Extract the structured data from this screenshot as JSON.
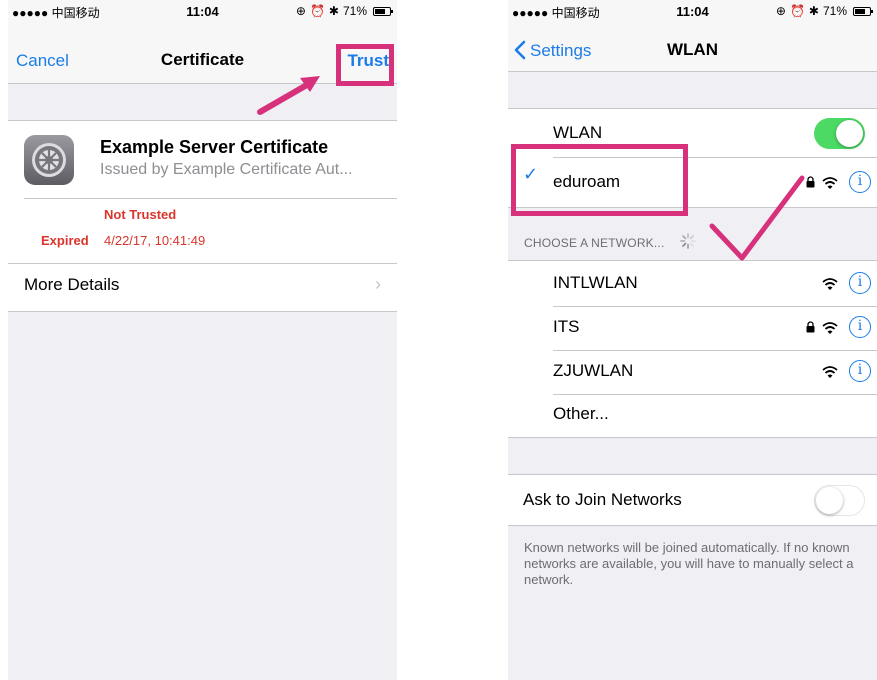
{
  "left_phone": {
    "status": {
      "carrier": "●●●●● 中国移动",
      "time": "11:04",
      "battery": "71%",
      "battery_level": 0.71
    },
    "nav": {
      "cancel": "Cancel",
      "title": "Certificate",
      "trust": "Trust"
    },
    "certificate": {
      "name": "Example Server Certificate",
      "issuer": "Issued by Example Certificate Aut...",
      "trust_status": "Not Trusted",
      "expired_label": "Expired",
      "expired_value": "4/22/17, 10:41:49",
      "more_details": "More Details"
    }
  },
  "right_phone": {
    "status": {
      "carrier": "●●●●● 中国移动",
      "time": "11:04",
      "battery": "71%",
      "battery_level": 0.71
    },
    "nav": {
      "back": "Settings",
      "title": "WLAN"
    },
    "wlan": {
      "label": "WLAN",
      "enabled": true
    },
    "connected": {
      "name": "eduroam",
      "locked": true
    },
    "section_header": "CHOOSE A NETWORK...",
    "networks": [
      {
        "name": "INTLWLAN",
        "locked": false
      },
      {
        "name": "ITS",
        "locked": true
      },
      {
        "name": "ZJUWLAN",
        "locked": false
      }
    ],
    "other": "Other...",
    "ask_to_join": {
      "label": "Ask to Join Networks",
      "enabled": false
    },
    "footer": "Known networks will be joined automatically. If no known networks are available, you will have to manually select a network."
  },
  "colors": {
    "ios_blue": "#1a7ce8",
    "annotation_pink": "#d6317a",
    "switch_green": "#4cd964",
    "warning_red": "#d9352c"
  },
  "icons": [
    "settings-gear-icon",
    "chevron-right-icon",
    "chevron-left-icon",
    "checkmark-icon",
    "lock-icon",
    "wifi-icon",
    "info-icon",
    "spinner-icon",
    "battery-icon",
    "alarm-icon",
    "bluetooth-icon",
    "rotation-lock-icon"
  ]
}
